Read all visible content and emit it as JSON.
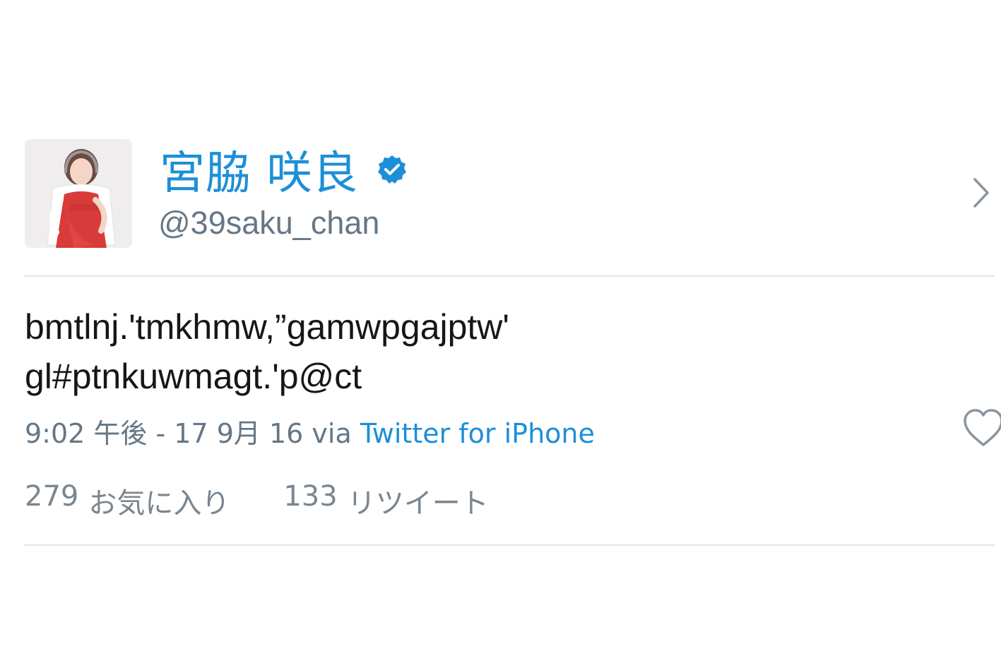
{
  "user": {
    "display_name": "宮脇 咲良",
    "handle": "@39saku_chan",
    "verified": true
  },
  "tweet": {
    "text_line1": "bmtlnj.'tmkhmw,”gamwpgajptw'",
    "text_line2": "gl#ptnkuwmagt.'p@ct",
    "timestamp": "9:02 午後 - 17 9月 16",
    "via_label": "via",
    "source": "Twitter for iPhone"
  },
  "stats": {
    "favorites_count": "279",
    "favorites_label": "お気に入り",
    "retweets_count": "133",
    "retweets_label": "リツイート"
  },
  "colors": {
    "link_blue": "#1d8fd8",
    "secondary_text": "#657786",
    "divider": "#e1e6ea"
  },
  "icons": {
    "verified": "verified-badge-icon",
    "chevron": "chevron-right-icon",
    "like": "heart-icon"
  }
}
